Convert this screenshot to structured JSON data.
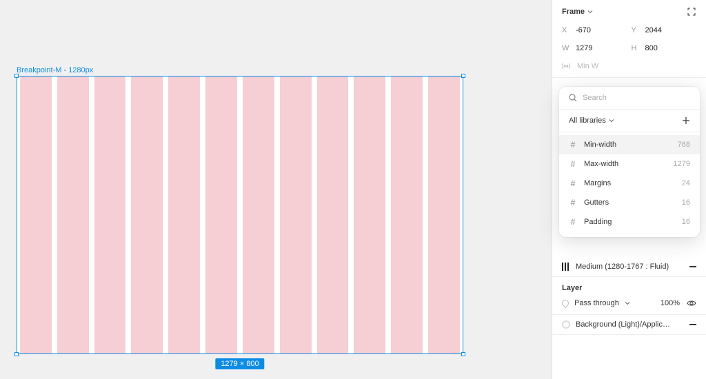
{
  "canvas": {
    "frame_label": "Breakpoint-M - 1280px",
    "size_badge": "1279 × 800"
  },
  "inspector": {
    "frame_section": {
      "title": "Frame"
    },
    "dims": {
      "x_label": "X",
      "x_value": "-670",
      "y_label": "Y",
      "y_value": "2044",
      "w_label": "W",
      "w_value": "1279",
      "h_label": "H",
      "h_value": "800",
      "minw_label": "Min W"
    },
    "popover": {
      "search_placeholder": "Search",
      "libraries_label": "All libraries",
      "items": [
        {
          "name": "Min-width",
          "value": "768"
        },
        {
          "name": "Max-width",
          "value": "1279"
        },
        {
          "name": "Margins",
          "value": "24"
        },
        {
          "name": "Gutters",
          "value": "16"
        },
        {
          "name": "Padding",
          "value": "16"
        }
      ]
    },
    "layout_grid": {
      "label": "Medium (1280-1767 : Fluid)"
    },
    "layer": {
      "title": "Layer",
      "blend": "Pass through",
      "opacity": "100%"
    },
    "fill": {
      "name": "Background (Light)/Applica..."
    }
  }
}
